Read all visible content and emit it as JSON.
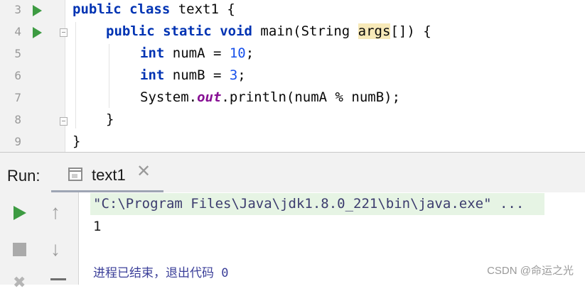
{
  "editor": {
    "lines": [
      {
        "number": "3",
        "text": "public class text1 {"
      },
      {
        "number": "4",
        "text": "public static void main(String args[]) {"
      },
      {
        "number": "5",
        "text": "int numA = 10;"
      },
      {
        "number": "6",
        "text": "int numB = 3;"
      },
      {
        "number": "7",
        "text": "System.out.println(numA % numB);"
      },
      {
        "number": "8",
        "text": "}"
      },
      {
        "number": "9",
        "text": "}"
      }
    ],
    "tokens": {
      "l3": {
        "kw1": "public",
        "kw2": "class",
        "rest": " text1 {"
      },
      "l4": {
        "kw1": "public",
        "kw2": "static",
        "kw3": "void",
        "mid": " main(String ",
        "param": "args",
        "rest": "[]) {"
      },
      "l5": {
        "kw": "int",
        "mid": " numA = ",
        "num": "10",
        "rest": ";"
      },
      "l6": {
        "kw": "int",
        "mid": " numB = ",
        "num": "3",
        "rest": ";"
      },
      "l7": {
        "pre": "System.",
        "field": "out",
        "rest": ".println(numA % numB);"
      },
      "l8": {
        "text": "}"
      },
      "l9": {
        "text": "}"
      }
    },
    "colors": {
      "keyword": "#0033b3",
      "number": "#1750eb",
      "field": "#871094",
      "run_icon": "#3d9b42"
    }
  },
  "run_panel": {
    "label": "Run:",
    "tab": {
      "label": "text1",
      "close": "✕"
    },
    "console": {
      "command": "\"C:\\Program Files\\Java\\jdk1.8.0_221\\bin\\java.exe\" ...",
      "output": "1",
      "exit_message": "进程已结束，退出代码 0"
    },
    "toolbar": {
      "rerun_icon": "play-icon",
      "stop_icon": "stop-icon",
      "up_icon": "arrow-up-icon",
      "down_icon": "arrow-down-icon"
    }
  },
  "watermark": "CSDN @命运之光"
}
